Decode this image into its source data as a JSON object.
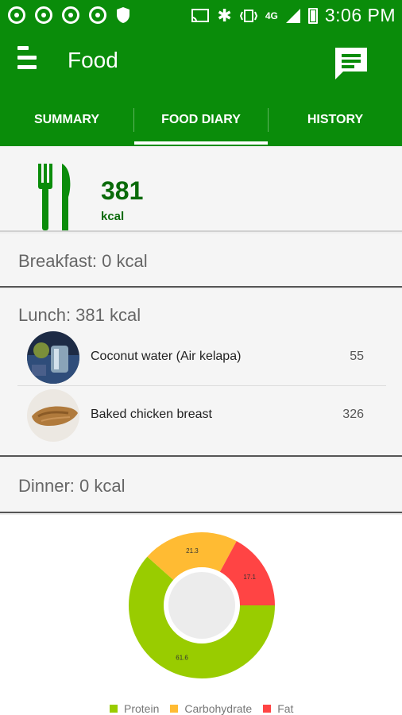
{
  "status_bar": {
    "network": "4G",
    "time": "3:06 PM"
  },
  "app_bar": {
    "title": "Food"
  },
  "tabs": [
    {
      "label": "SUMMARY"
    },
    {
      "label": "FOOD DIARY"
    },
    {
      "label": "HISTORY"
    }
  ],
  "total": {
    "value": "381",
    "unit": "kcal"
  },
  "meals": {
    "breakfast": {
      "title": "Breakfast: 0 kcal"
    },
    "lunch": {
      "title": "Lunch: 381 kcal",
      "items": [
        {
          "name": "Coconut water (Air kelapa)",
          "kcal": "55"
        },
        {
          "name": "Baked chicken breast",
          "kcal": "326"
        }
      ]
    },
    "dinner": {
      "title": "Dinner: 0 kcal"
    }
  },
  "colors": {
    "primary": "#0a8c0a",
    "protein": "#99cc00",
    "carbohydrate": "#ffbb33",
    "fat": "#ff4444"
  },
  "chart_data": {
    "type": "pie",
    "categories": [
      "Protein",
      "Carbohydrate",
      "Fat"
    ],
    "values": [
      61.6,
      21.3,
      17.1
    ],
    "labels": [
      "61.6",
      "21.3",
      "17.1"
    ],
    "legend": "bottom"
  }
}
